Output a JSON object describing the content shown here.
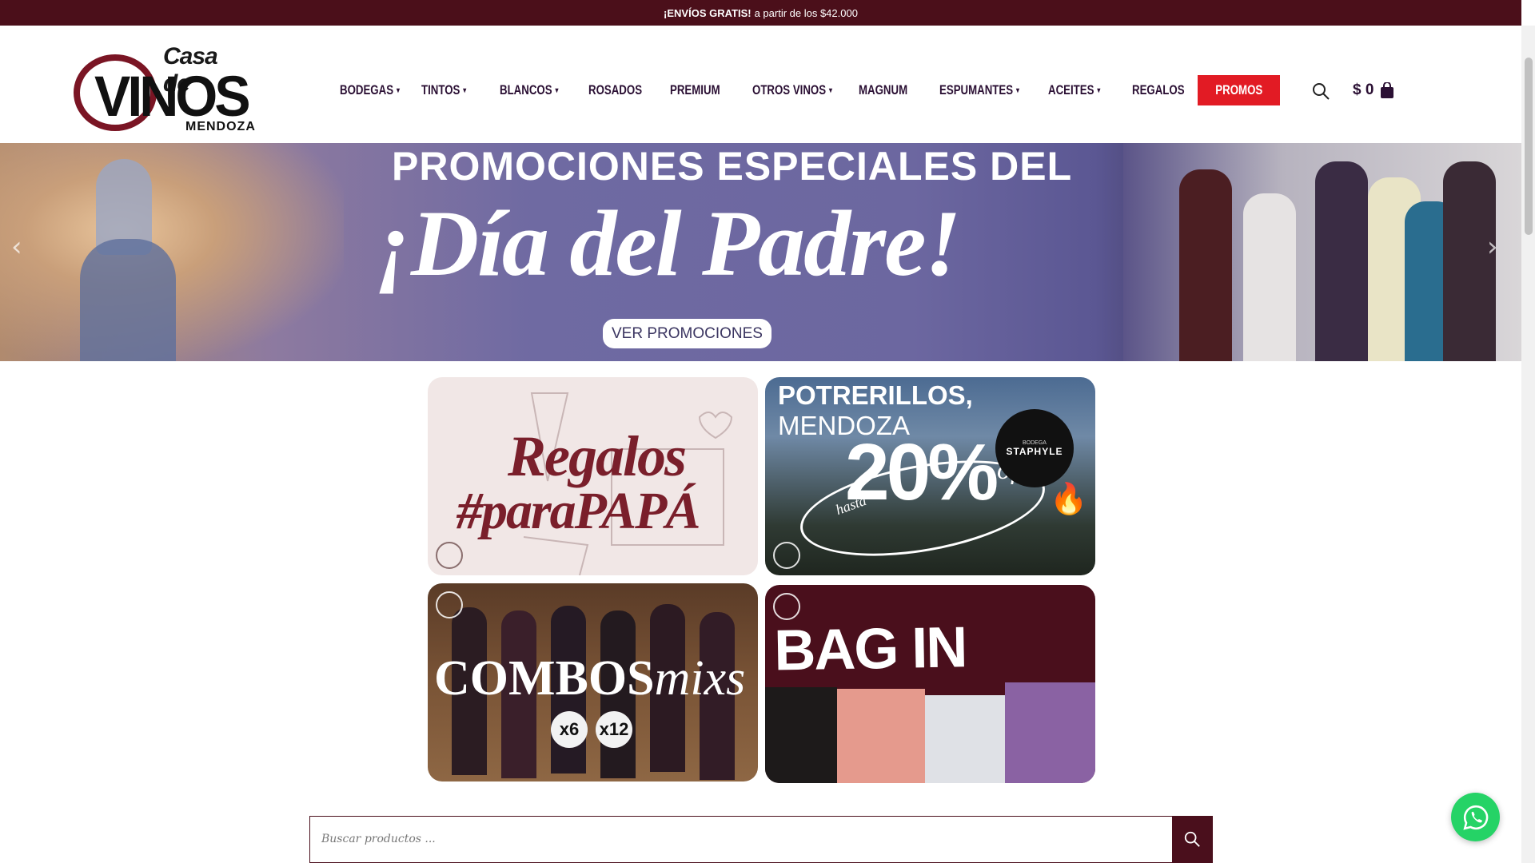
{
  "topbar": {
    "bold": "¡ENVÍOS GRATIS!",
    "text": "a partir de los $42.000"
  },
  "logo": {
    "casa": "Casa de",
    "vinos": "VINOS",
    "mendoza": "MENDOZA"
  },
  "nav": [
    {
      "label": "BODEGAS",
      "dropdown": true
    },
    {
      "label": "TINTOS",
      "dropdown": true
    },
    {
      "label": "BLANCOS",
      "dropdown": true
    },
    {
      "label": "ROSADOS",
      "dropdown": false
    },
    {
      "label": "PREMIUM",
      "dropdown": false
    },
    {
      "label": "OTROS VINOS",
      "dropdown": true
    },
    {
      "label": "MAGNUM",
      "dropdown": false
    },
    {
      "label": "ESPUMANTES",
      "dropdown": true
    },
    {
      "label": "ACEITES",
      "dropdown": true
    },
    {
      "label": "REGALOS",
      "dropdown": false
    }
  ],
  "promos_label": "PROMOS",
  "cart": {
    "total": "$ 0"
  },
  "hero": {
    "title_top": "PROMOCIONES ESPECIALES DEL",
    "title_main": "¡Día del Padre!",
    "cta": "VER PROMOCIONES"
  },
  "cards": {
    "regalos": {
      "line1": "Regalos",
      "line2": "#paraPAPÁ"
    },
    "potrerillos": {
      "place_bold": "POTRERILLOS,",
      "place_rest": " MENDOZA",
      "hasta": "hasta",
      "pct": "20%",
      "off": "off",
      "brand_small": "BODEGA",
      "brand": "STAPHYLE"
    },
    "combos": {
      "bold": "COMBOS",
      "italic": "mixs",
      "x6": "x6",
      "x12": "x12"
    },
    "bag": {
      "title": "BAG IN BOX"
    }
  },
  "search": {
    "placeholder": "Buscar productos ..."
  },
  "colors": {
    "brand": "#4b0f1a",
    "accent": "#e21b24",
    "whatsapp": "#25d366"
  }
}
